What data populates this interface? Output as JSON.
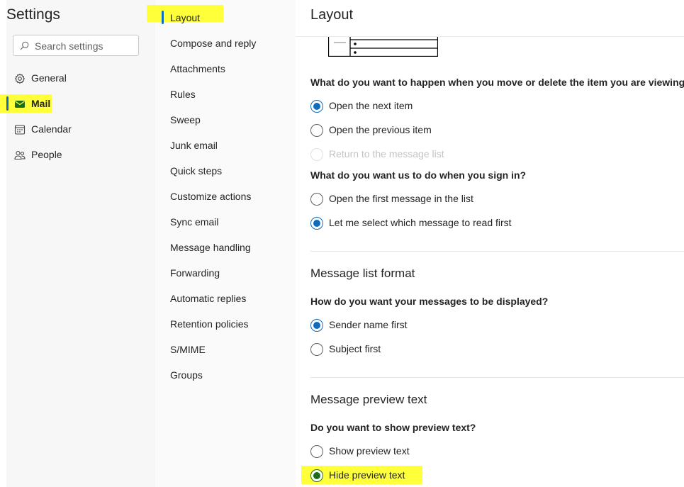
{
  "settings": {
    "title": "Settings",
    "search_placeholder": "Search settings"
  },
  "nav": {
    "items": [
      {
        "label": "General",
        "icon": "gear-icon"
      },
      {
        "label": "Mail",
        "icon": "mail-icon",
        "selected": true
      },
      {
        "label": "Calendar",
        "icon": "calendar-icon"
      },
      {
        "label": "People",
        "icon": "people-icon"
      }
    ]
  },
  "subnav": {
    "items": [
      {
        "label": "Layout",
        "selected": true
      },
      {
        "label": "Compose and reply"
      },
      {
        "label": "Attachments"
      },
      {
        "label": "Rules"
      },
      {
        "label": "Sweep"
      },
      {
        "label": "Junk email"
      },
      {
        "label": "Quick steps"
      },
      {
        "label": "Customize actions"
      },
      {
        "label": "Sync email"
      },
      {
        "label": "Message handling"
      },
      {
        "label": "Forwarding"
      },
      {
        "label": "Automatic replies"
      },
      {
        "label": "Retention policies"
      },
      {
        "label": "S/MIME"
      },
      {
        "label": "Groups"
      }
    ]
  },
  "main": {
    "title": "Layout",
    "move_delete": {
      "question": "What do you want to happen when you move or delete the item you are viewing?",
      "options": [
        {
          "label": "Open the next item",
          "checked": true
        },
        {
          "label": "Open the previous item",
          "checked": false
        },
        {
          "label": "Return to the message list",
          "checked": false,
          "disabled": true
        }
      ]
    },
    "sign_in": {
      "question": "What do you want us to do when you sign in?",
      "options": [
        {
          "label": "Open the first message in the list",
          "checked": false
        },
        {
          "label": "Let me select which message to read first",
          "checked": true
        }
      ]
    },
    "message_list_format": {
      "heading": "Message list format",
      "question": "How do you want your messages to be displayed?",
      "options": [
        {
          "label": "Sender name first",
          "checked": true
        },
        {
          "label": "Subject first",
          "checked": false
        }
      ]
    },
    "preview_text": {
      "heading": "Message preview text",
      "question": "Do you want to show preview text?",
      "options": [
        {
          "label": "Show preview text",
          "checked": false
        },
        {
          "label": "Hide preview text",
          "checked": true
        }
      ]
    }
  },
  "colors": {
    "accent": "#0f6cbd",
    "highlight": "#ffff3a",
    "highlighted_selection": "#1b6d1b",
    "mail_icon": "#1b6d1b"
  }
}
